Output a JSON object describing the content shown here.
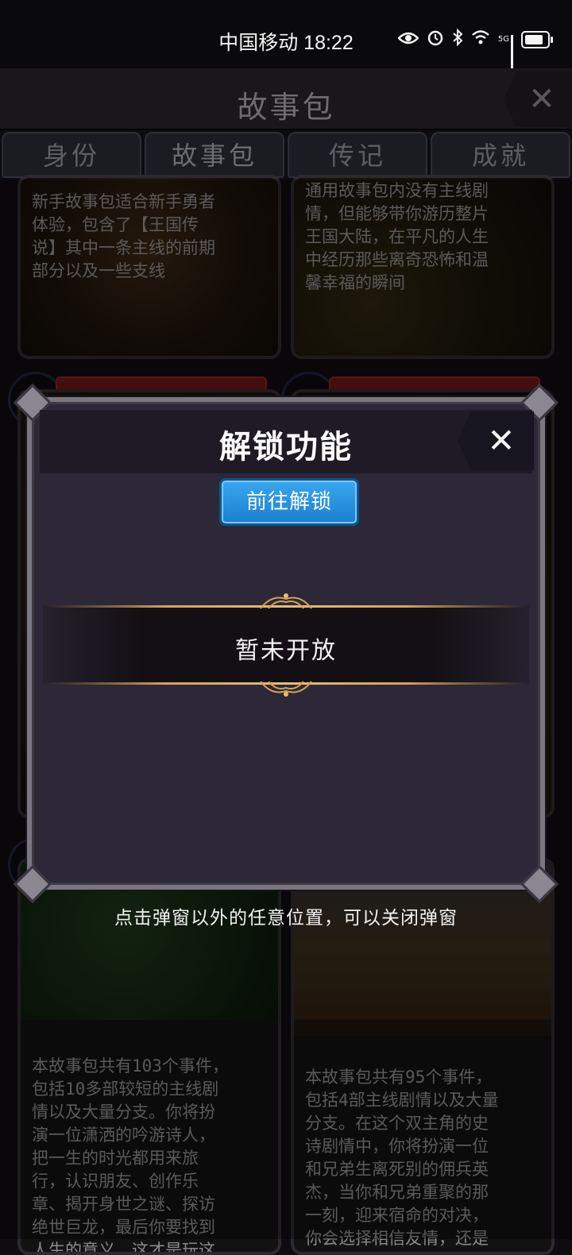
{
  "status_bar": {
    "carrier_time": "中国移动 18:22",
    "network": "5G",
    "icons": [
      "eye-icon",
      "alarm-icon",
      "bluetooth-icon",
      "wifi-icon",
      "signal-icon",
      "battery-icon"
    ]
  },
  "header": {
    "title": "故事包",
    "close_icon": "close-icon"
  },
  "tabs": [
    {
      "label": "身份"
    },
    {
      "label": "故事包"
    },
    {
      "label": "传记"
    },
    {
      "label": "成就"
    }
  ],
  "cards": [
    {
      "description": "新手故事包适合新手勇者\n体验，包含了【王国传\n说】其中一条主线的前期\n部分以及一些支线"
    },
    {
      "description": "通用故事包内没有主线剧\n情，但能够带你游历整片\n王国大陆，在平凡的人生\n中经历那些离奇恐怖和温\n馨幸福的瞬间"
    },
    {
      "description": "本故事包共有103个事件，\n包括10多部较短的主线剧\n情以及大量分支。你将扮\n演一位潇洒的吟游诗人，\n把一生的时光都用来旅\n行，认识朋友、创作乐\n章、揭开身世之谜、探访\n绝世巨龙，最后你要找到\n人生的意义，这才是玩这"
    },
    {
      "description": "本故事包共有95个事件，\n包括4部主线剧情以及大量\n分支。在这个双主角的史\n诗剧情中，你将扮演一位\n和兄弟生离死别的佣兵英\n杰，当你和兄弟重聚的那\n一刻，迎来宿命的对决，\n你会选择相信友情，还是"
    }
  ],
  "modal": {
    "title": "解锁功能",
    "unlock_button": "前往解锁",
    "status_text": "暂未开放",
    "close_icon": "close-icon"
  },
  "hint": "点击弹窗以外的任意位置，可以关闭弹窗",
  "colors": {
    "accent_blue": "#2a93e3",
    "modal_bg": "#2c2838",
    "gold_line": "#e7bd72",
    "ribbon_red": "#6a1516"
  }
}
